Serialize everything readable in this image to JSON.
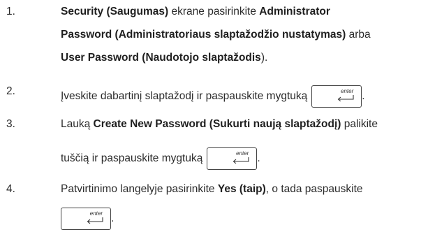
{
  "steps": [
    {
      "number": "1.",
      "lines": [
        [
          {
            "t": "Security (Saugumas)",
            "b": true
          },
          {
            "t": " ekrane pasirinkite ",
            "b": false
          },
          {
            "t": "Administrator",
            "b": true
          }
        ],
        [
          {
            "t": "Password (Administratoriaus slaptažodžio nustatymas)",
            "b": true
          },
          {
            "t": " arba",
            "b": false
          }
        ],
        [
          {
            "t": "User Password (Naudotojo slaptažodis",
            "b": true
          },
          {
            "t": ").",
            "b": false
          }
        ]
      ]
    },
    {
      "number": "2.",
      "lines": [
        [
          {
            "t": "Įveskite dabartinį slaptažodį ir paspauskite mygtuką",
            "b": false
          },
          {
            "key": true
          },
          {
            "t": ".",
            "b": false
          }
        ]
      ]
    },
    {
      "number": "3.",
      "lines": [
        [
          {
            "t": "Lauką ",
            "b": false
          },
          {
            "t": "Create New Password (Sukurti naują slaptažodį)",
            "b": true
          },
          {
            "t": " palikite",
            "b": false
          }
        ],
        [
          {
            "t": "tuščią ir paspauskite mygtuką",
            "b": false
          },
          {
            "key": true
          },
          {
            "t": ".",
            "b": false
          }
        ]
      ]
    },
    {
      "number": "4.",
      "lines": [
        [
          {
            "t": "Patvirtinimo langelyje pasirinkite ",
            "b": false
          },
          {
            "t": "Yes (taip)",
            "b": true
          },
          {
            "t": ", o tada paspauskite",
            "b": false
          }
        ],
        [
          {
            "key": true
          },
          {
            "t": ".",
            "b": false
          }
        ]
      ]
    }
  ],
  "key_label": "enter",
  "key_icon": "enter-arrow-icon"
}
